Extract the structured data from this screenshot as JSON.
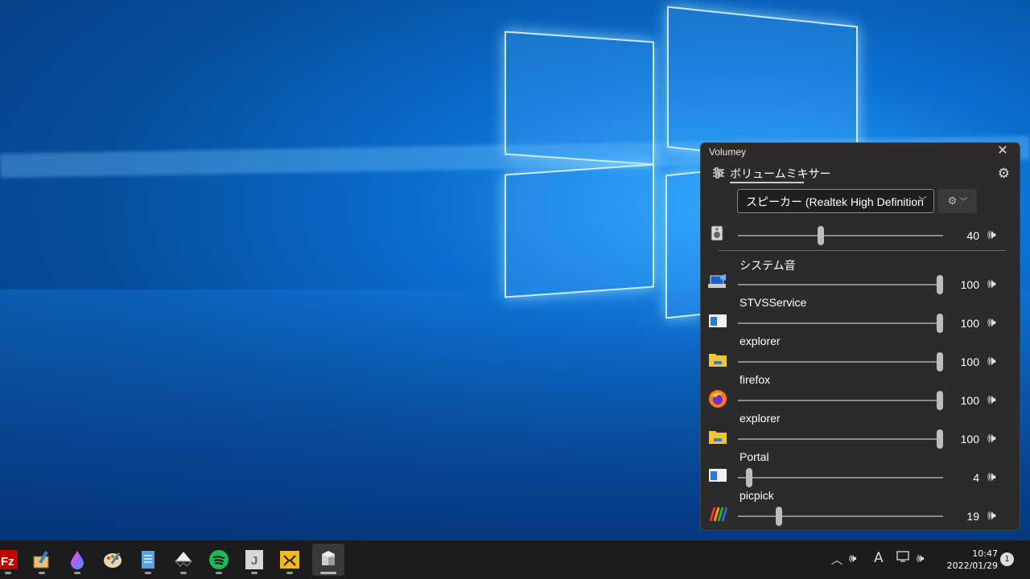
{
  "window": {
    "title": "Volumey",
    "tab_label": "ボリュームミキサー"
  },
  "device": {
    "selected": "スピーカー (Realtek High Definition",
    "volume": 40,
    "volume_label": "40"
  },
  "apps": [
    {
      "name": "システム音",
      "volume": 100,
      "volume_label": "100",
      "icon": "system-sounds-icon"
    },
    {
      "name": "STVSService",
      "volume": 100,
      "volume_label": "100",
      "icon": "window-app-icon"
    },
    {
      "name": "explorer",
      "volume": 100,
      "volume_label": "100",
      "icon": "folder-icon"
    },
    {
      "name": "firefox",
      "volume": 100,
      "volume_label": "100",
      "icon": "firefox-icon"
    },
    {
      "name": "explorer",
      "volume": 100,
      "volume_label": "100",
      "icon": "folder-icon"
    },
    {
      "name": "Portal",
      "volume": 4,
      "volume_label": "4",
      "icon": "window-app-icon"
    },
    {
      "name": "picpick",
      "volume": 19,
      "volume_label": "19",
      "icon": "picpick-icon"
    }
  ],
  "taskbar": {
    "apps": [
      "filezilla-icon",
      "paint-tool-icon",
      "color-drop-icon",
      "palette-icon",
      "notepad-icon",
      "inkscape-icon",
      "spotify-icon",
      "j-app-icon",
      "network-tool-icon",
      "volumey-icon"
    ],
    "ime_label": "A",
    "time": "10:47",
    "date": "2022/01/29",
    "notifications": "1"
  },
  "colors": {
    "panel_bg": "#2b2b2b",
    "taskbar_bg": "#1c1c1c",
    "accent": "#0a6fd0"
  }
}
